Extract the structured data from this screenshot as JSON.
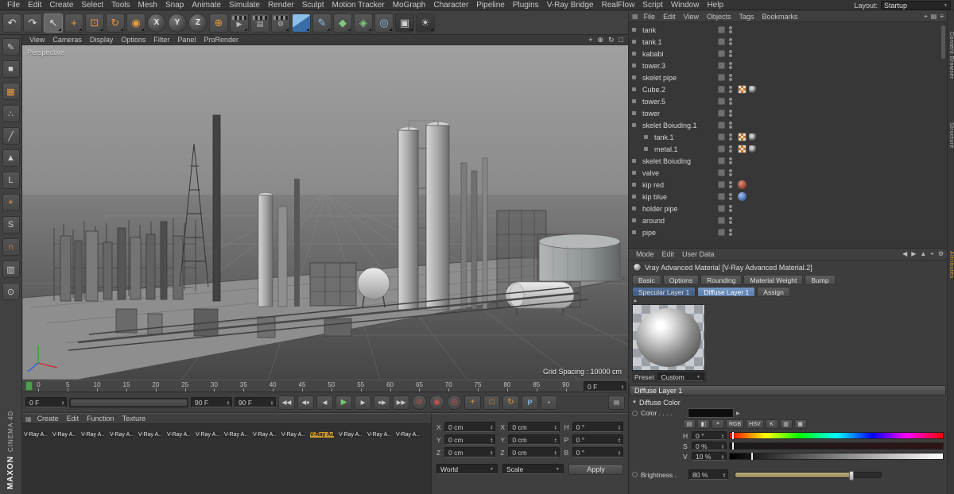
{
  "menubar": {
    "items": [
      "File",
      "Edit",
      "Create",
      "Select",
      "Tools",
      "Mesh",
      "Snap",
      "Animate",
      "Simulate",
      "Render",
      "Sculpt",
      "Motion Tracker",
      "MoGraph",
      "Character",
      "Pipeline",
      "Plugins",
      "V-Ray Bridge",
      "RealFlow",
      "Script",
      "Window",
      "Help"
    ],
    "layout_label": "Layout:",
    "layout_value": "Startup"
  },
  "branding": {
    "line1": "MAXON",
    "line2": "CINEMA 4D"
  },
  "toolbar": {
    "buttons": [
      {
        "glyph": "↶",
        "name": "undo-button",
        "cls": "plain"
      },
      {
        "glyph": "↷",
        "name": "redo-button",
        "cls": "plain"
      },
      {
        "glyph": "↖",
        "name": "live-selection-button",
        "cls": "pressed dd"
      },
      {
        "glyph": "+",
        "name": "move-tool-button",
        "cls": "orange dd"
      },
      {
        "glyph": "⊡",
        "name": "scale-tool-button",
        "cls": "orange dd"
      },
      {
        "glyph": "↻",
        "name": "rotate-tool-button",
        "cls": "orange dd"
      },
      {
        "glyph": "◉",
        "name": "last-tool-button",
        "cls": "orange dd"
      },
      {
        "glyph": "X",
        "name": "lock-x-axis-button",
        "cls": "axis"
      },
      {
        "glyph": "Y",
        "name": "lock-y-axis-button",
        "cls": "axis"
      },
      {
        "glyph": "Z",
        "name": "lock-z-axis-button",
        "cls": "axis"
      },
      {
        "glyph": "⊕",
        "name": "coordinate-system-button",
        "cls": "orange"
      },
      {
        "glyph": "▶",
        "name": "render-view-button",
        "cls": "render dd"
      },
      {
        "glyph": "▤",
        "name": "render-picture-viewer-button",
        "cls": "render"
      },
      {
        "glyph": "⚙",
        "name": "render-settings-button",
        "cls": "render dd"
      },
      {
        "glyph": "",
        "name": "add-cube-button",
        "cls": "cube dd"
      },
      {
        "glyph": "✎",
        "name": "add-spline-button",
        "cls": "blue dd"
      },
      {
        "glyph": "◆",
        "name": "add-generator-button",
        "cls": "green dd"
      },
      {
        "glyph": "◈",
        "name": "add-mograph-button",
        "cls": "green dd"
      },
      {
        "glyph": "◎",
        "name": "add-deformer-button",
        "cls": "blue dd"
      },
      {
        "glyph": "▣",
        "name": "add-camera-button",
        "cls": "dark dd"
      },
      {
        "glyph": "☀",
        "name": "add-light-button",
        "cls": "dark dd"
      }
    ]
  },
  "left_tools": [
    {
      "glyph": "✎",
      "name": "make-editable-button",
      "cls": ""
    },
    {
      "glyph": "■",
      "name": "model-mode-button",
      "cls": ""
    },
    {
      "glyph": "▦",
      "name": "texture-mode-button",
      "cls": "orange"
    },
    {
      "glyph": "∴",
      "name": "points-mode-button",
      "cls": ""
    },
    {
      "glyph": "╱",
      "name": "edges-mode-button",
      "cls": ""
    },
    {
      "glyph": "▲",
      "name": "polygons-mode-button",
      "cls": ""
    },
    {
      "glyph": "L",
      "name": "axis-mode-button",
      "cls": ""
    },
    {
      "glyph": "⌖",
      "name": "viewport-solo-button",
      "cls": "orange"
    },
    {
      "glyph": "S",
      "name": "simulation-button",
      "cls": ""
    },
    {
      "glyph": "∩",
      "name": "snap-button",
      "cls": "orange"
    },
    {
      "glyph": "▥",
      "name": "workplane-button",
      "cls": ""
    },
    {
      "glyph": "⊙",
      "name": "locked-workplane-button",
      "cls": ""
    }
  ],
  "viewport": {
    "menus": [
      "View",
      "Cameras",
      "Display",
      "Options",
      "Filter",
      "Panel",
      "ProRender"
    ],
    "nav_icons": [
      {
        "glyph": "+",
        "name": "pan-view-icon"
      },
      {
        "glyph": "⊕",
        "name": "zoom-view-icon"
      },
      {
        "glyph": "↻",
        "name": "rotate-view-icon"
      },
      {
        "glyph": "□",
        "name": "toggle-view-icon"
      }
    ],
    "camera_label": "Perspective",
    "grid_spacing": "Grid Spacing : 10000 cm"
  },
  "timeline": {
    "ticks": [
      "0",
      "5",
      "10",
      "15",
      "20",
      "25",
      "30",
      "35",
      "40",
      "45",
      "50",
      "55",
      "60",
      "65",
      "70",
      "75",
      "80",
      "85",
      "90"
    ],
    "current_frame": "0 F",
    "range_start": "0 F",
    "range_end": "90 F",
    "range_end_alt": "90 F",
    "transport": [
      {
        "glyph": "◀◀",
        "name": "go-to-start-button",
        "cls": ""
      },
      {
        "glyph": "◀●",
        "name": "previous-key-button",
        "cls": ""
      },
      {
        "glyph": "◀",
        "name": "previous-frame-button",
        "cls": ""
      },
      {
        "glyph": "▶",
        "name": "play-button",
        "cls": "green"
      },
      {
        "glyph": "▶",
        "name": "next-frame-button",
        "cls": ""
      },
      {
        "glyph": "●▶",
        "name": "next-key-button",
        "cls": ""
      },
      {
        "glyph": "▶▶",
        "name": "go-to-end-button",
        "cls": ""
      }
    ],
    "record_buttons": [
      {
        "glyph": "⊘",
        "name": "play-sound-button",
        "cls": "redring"
      },
      {
        "glyph": "◉",
        "name": "record-button",
        "cls": "redring"
      },
      {
        "glyph": "◎",
        "name": "autokey-button",
        "cls": "redring"
      }
    ],
    "key_buttons": [
      {
        "glyph": "+",
        "name": "record-position-button",
        "cls": "orange"
      },
      {
        "glyph": "□",
        "name": "record-scale-button",
        "cls": "orange"
      },
      {
        "glyph": "↻",
        "name": "record-rotation-button",
        "cls": "orange"
      },
      {
        "glyph": "P",
        "name": "record-parameter-button",
        "cls": "blue"
      },
      {
        "glyph": "•",
        "name": "record-pla-button",
        "cls": ""
      }
    ]
  },
  "materials": {
    "menus": [
      "Create",
      "Edit",
      "Function",
      "Texture"
    ],
    "items": [
      {
        "label": "V-Ray A..",
        "color": "#9c9c9c",
        "cls": ""
      },
      {
        "label": "V-Ray A..",
        "color": "#ababab",
        "cls": ""
      },
      {
        "label": "V-Ray A..",
        "color": "#b3a98f",
        "cls": ""
      },
      {
        "label": "V-Ray A..",
        "color": "#8e8e8e",
        "cls": ""
      },
      {
        "label": "V-Ray A..",
        "color": "#a2a2a2",
        "cls": ""
      },
      {
        "label": "V-Ray A..",
        "color": "#7c2a22",
        "cls": ""
      },
      {
        "label": "V-Ray A..",
        "color": "#34344a",
        "cls": ""
      },
      {
        "label": "V-Ray A..",
        "color": "#949494",
        "cls": ""
      },
      {
        "label": "V-Ray A..",
        "color": "#6e6a62",
        "cls": ""
      },
      {
        "label": "V-Ray A..",
        "color": "#a6a6a6",
        "cls": ""
      },
      {
        "label": "V-Ray Ad",
        "color": "#d2d2d2",
        "cls": "selected"
      },
      {
        "label": "V-Ray A..",
        "color": "#8a8a8a",
        "cls": ""
      },
      {
        "label": "V-Ray A..",
        "color": "#c4c4c4",
        "cls": ""
      },
      {
        "label": "V-Ray A..",
        "color": "#9a9a9a",
        "cls": ""
      }
    ],
    "row2": [
      {
        "label": "",
        "color": "#a2a2a2",
        "cls": ""
      },
      {
        "label": "",
        "color": "#8f8f8f",
        "cls": ""
      },
      {
        "label": "",
        "color": "#474747",
        "cls": ""
      }
    ]
  },
  "coordinates": {
    "cells": [
      {
        "label": "X",
        "value": "0 cm",
        "name": "position-x-input"
      },
      {
        "label": "X",
        "value": "0 cm",
        "name": "size-x-input"
      },
      {
        "label": "H",
        "value": "0 °",
        "name": "rotation-h-input"
      },
      {
        "label": "Y",
        "value": "0 cm",
        "name": "position-y-input"
      },
      {
        "label": "Y",
        "value": "0 cm",
        "name": "size-y-input"
      },
      {
        "label": "P",
        "value": "0 °",
        "name": "rotation-p-input"
      },
      {
        "label": "Z",
        "value": "0 cm",
        "name": "position-z-input"
      },
      {
        "label": "Z",
        "value": "0 cm",
        "name": "size-z-input"
      },
      {
        "label": "B",
        "value": "0 °",
        "name": "rotation-b-input"
      }
    ],
    "dropdown_world": "World",
    "dropdown_scale": "Scale",
    "apply_label": "Apply"
  },
  "object_manager": {
    "menus": [
      "File",
      "Edit",
      "View",
      "Objects",
      "Tags",
      "Bookmarks"
    ],
    "header_icons": [
      {
        "glyph": "⌖",
        "name": "search-icon"
      },
      {
        "glyph": "▤",
        "name": "filter-icon"
      },
      {
        "glyph": "≡",
        "name": "panel-menu-icon"
      }
    ],
    "items": [
      {
        "name": "tank",
        "icon": "obj",
        "cls": "",
        "tags": []
      },
      {
        "name": "tank.1",
        "icon": "obj",
        "cls": "",
        "tags": []
      },
      {
        "name": "kababi",
        "icon": "obj",
        "cls": "",
        "tags": []
      },
      {
        "name": "tower.3",
        "icon": "obj",
        "cls": "",
        "tags": []
      },
      {
        "name": "skelet pipe",
        "icon": "obj",
        "cls": "",
        "tags": []
      },
      {
        "name": "Cube.2",
        "icon": "poly",
        "cls": "",
        "tags": [
          "checker",
          "photo"
        ]
      },
      {
        "name": "tower.5",
        "icon": "obj",
        "cls": "",
        "tags": []
      },
      {
        "name": "tower",
        "icon": "obj",
        "cls": "",
        "tags": []
      },
      {
        "name": "skelet Boiuding.1",
        "icon": "obj",
        "cls": "",
        "tags": []
      },
      {
        "name": "tank.1",
        "icon": "poly",
        "cls": "child",
        "tags": [
          "checker",
          "photo"
        ]
      },
      {
        "name": "metal.1",
        "icon": "poly",
        "cls": "child",
        "tags": [
          "checker",
          "photo"
        ]
      },
      {
        "name": "skelet Boiuding",
        "icon": "obj",
        "cls": "",
        "tags": []
      },
      {
        "name": "valve",
        "icon": "obj",
        "cls": "",
        "tags": []
      },
      {
        "name": "kip red",
        "icon": "obj",
        "cls": "",
        "tags": [
          "red"
        ]
      },
      {
        "name": "kip blue",
        "icon": "obj",
        "cls": "",
        "tags": [
          "blue"
        ]
      },
      {
        "name": "holder pipe",
        "icon": "obj",
        "cls": "",
        "tags": []
      },
      {
        "name": "around",
        "icon": "obj",
        "cls": "",
        "tags": []
      },
      {
        "name": "pipe",
        "icon": "obj",
        "cls": "",
        "tags": []
      }
    ]
  },
  "attributes": {
    "menus": [
      "Mode",
      "Edit",
      "User Data"
    ],
    "header_icons": [
      {
        "glyph": "◀",
        "name": "history-back-icon"
      },
      {
        "glyph": "▶",
        "name": "history-forward-icon"
      },
      {
        "glyph": "▲",
        "name": "parent-object-icon"
      },
      {
        "glyph": "⌖",
        "name": "search-icon"
      },
      {
        "glyph": "⚙",
        "name": "settings-icon"
      }
    ],
    "material_title": "Vray Advanced Material [V-Ray Advanced Material.2]",
    "tabs_row1": [
      {
        "label": "Basic",
        "cls": ""
      },
      {
        "label": "Options",
        "cls": ""
      },
      {
        "label": "Rounding",
        "cls": ""
      },
      {
        "label": "Material Weight",
        "cls": ""
      },
      {
        "label": "Bump",
        "cls": ""
      }
    ],
    "tabs_row2": [
      {
        "label": "Specular Layer 1",
        "cls": "bluetab"
      },
      {
        "label": "Diffuse Layer 1",
        "cls": "bluetab selected"
      },
      {
        "label": "Assign",
        "cls": ""
      }
    ],
    "preset_label": "Preset",
    "preset_value": "Custom",
    "section_title": "Diffuse Layer 1",
    "subsection_title": "Diffuse Color",
    "color_label": "Color . . . .",
    "color_value": "#0d0d0d",
    "picker_icons": [
      {
        "glyph": "▤",
        "name": "compact-mode-icon"
      },
      {
        "glyph": "◧",
        "name": "color-wheel-icon"
      },
      {
        "glyph": "⌖",
        "name": "screen-picker-icon"
      },
      {
        "glyph": "RGB",
        "name": "rgb-mode-button"
      },
      {
        "glyph": "HSV",
        "name": "hsv-mode-button"
      },
      {
        "glyph": "K",
        "name": "kelvin-mode-button"
      },
      {
        "glyph": "▥",
        "name": "color-mixer-icon"
      },
      {
        "glyph": "▦",
        "name": "color-swatches-icon"
      }
    ],
    "hsv_rows": [
      {
        "label": "H",
        "value": "0 °",
        "bar": "hue",
        "marker": "1%",
        "name": "hue-input"
      },
      {
        "label": "S",
        "value": "0 %",
        "bar": "sat",
        "marker": "1%",
        "name": "saturation-input"
      },
      {
        "label": "V",
        "value": "10 %",
        "bar": "val",
        "marker": "10%",
        "name": "value-input"
      }
    ],
    "brightness_label": "Brightness .",
    "brightness_value": "80 %",
    "brightness_pct": "80%"
  },
  "side_tabs": [
    {
      "label": "Content Browser",
      "cls": ""
    },
    {
      "label": "Structure",
      "cls": ""
    },
    {
      "label": "Attributes",
      "cls": "active"
    }
  ]
}
